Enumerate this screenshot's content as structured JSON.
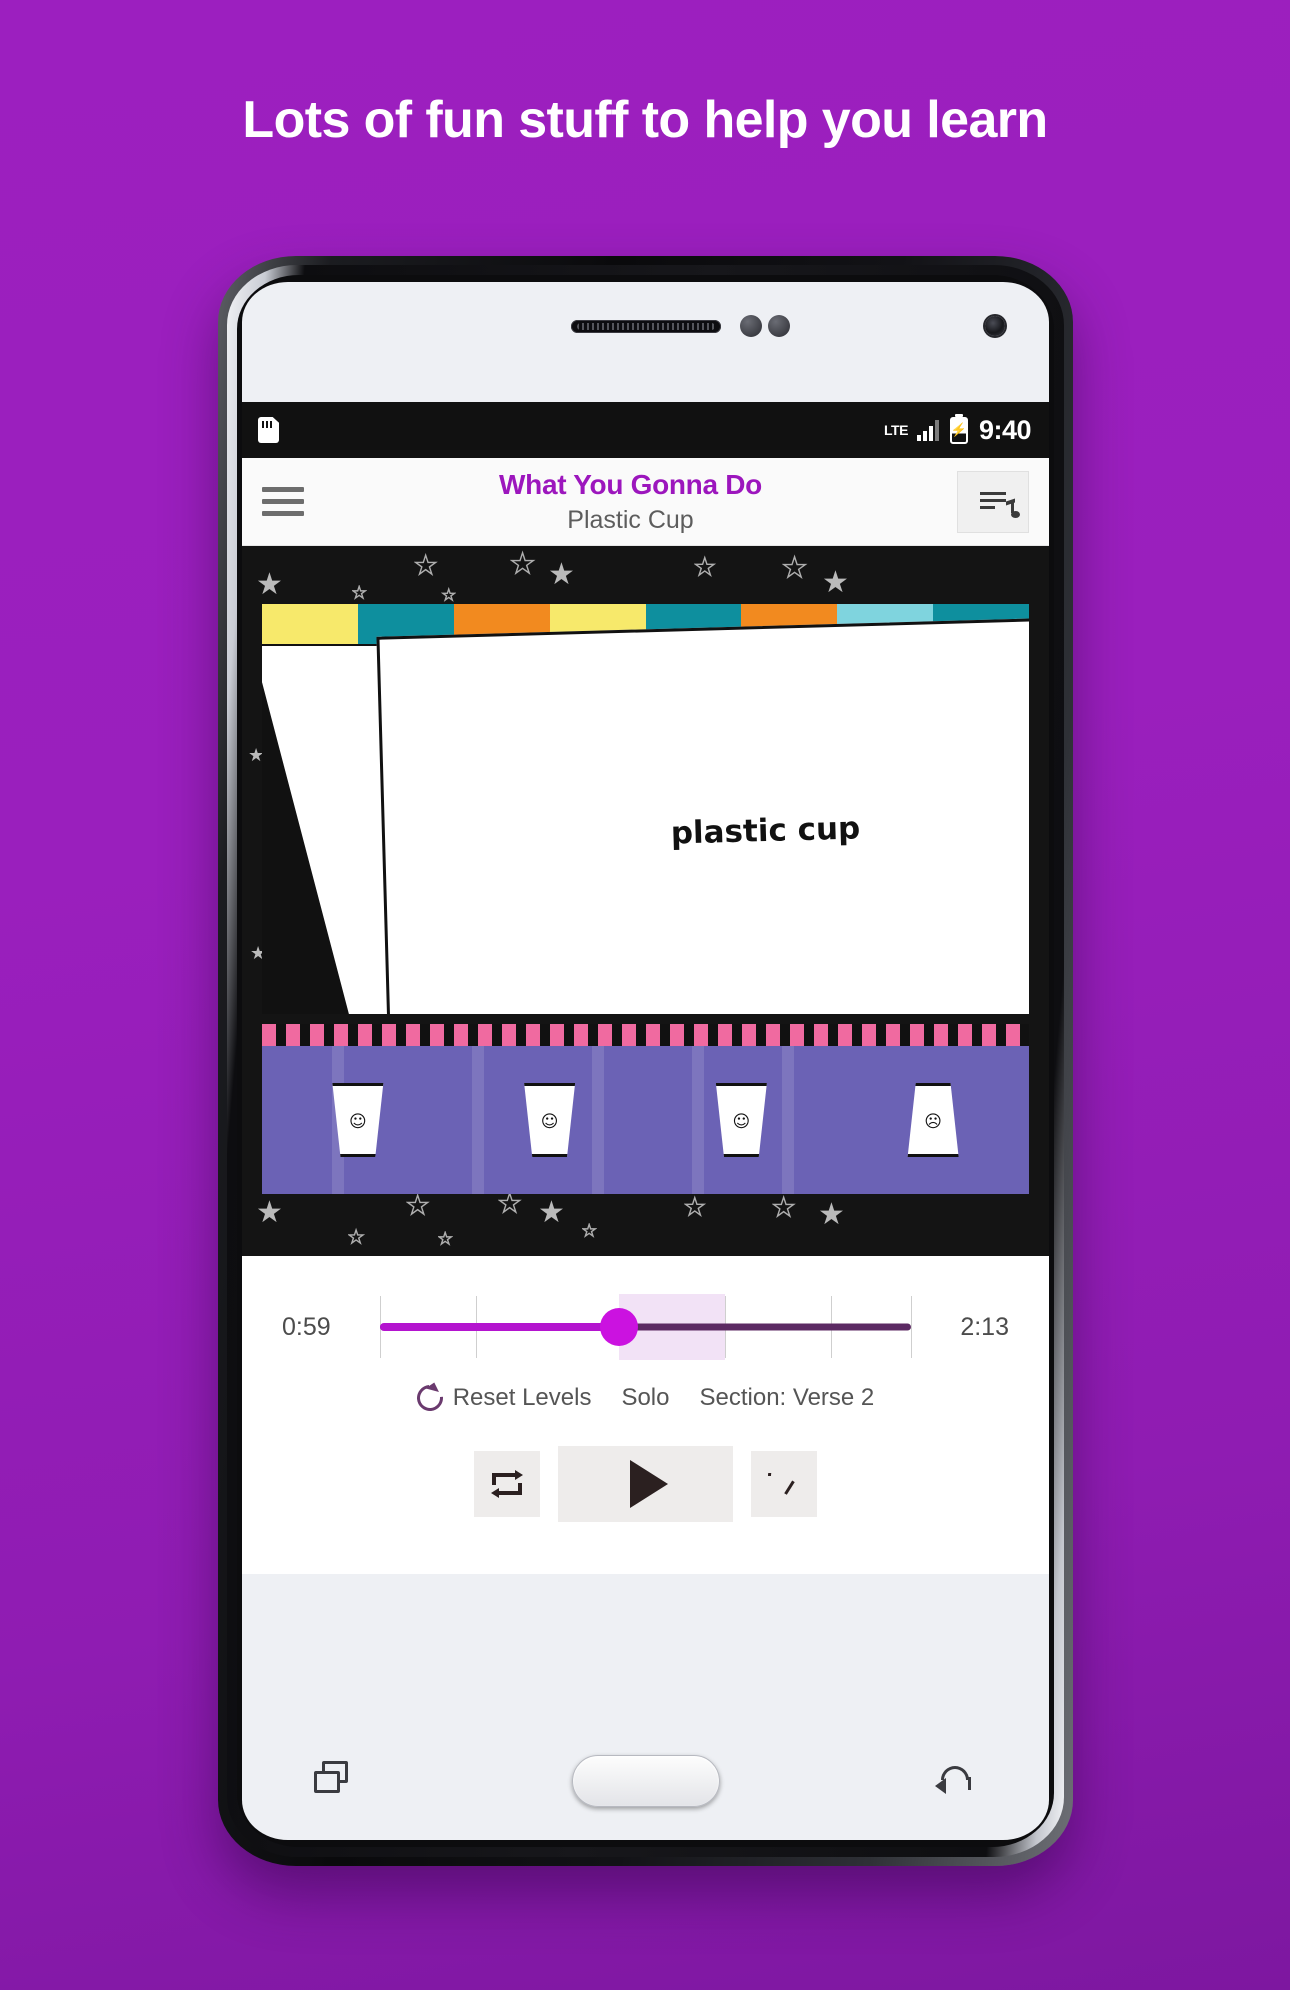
{
  "promo": {
    "headline": "Lots of fun stuff to help you learn",
    "background_color": "#9b1fbe"
  },
  "device": {
    "statusbar": {
      "sd_icon": "sd-card-icon",
      "network_label": "LTE",
      "signal_icon": "signal-bars-icon",
      "battery_icon": "battery-charging-icon",
      "time": "9:40"
    },
    "navbar": {
      "recents": "recents-icon",
      "home": "home-button",
      "back": "back-icon"
    }
  },
  "app": {
    "toolbar": {
      "menu_icon": "hamburger-menu-icon",
      "song_title": "What You Gonna Do",
      "artist": "Plastic Cup",
      "playlist_icon": "playlist-music-icon",
      "title_color": "#9c16bd"
    },
    "artwork": {
      "album_banner_text": "plastic cup",
      "drum_head_line1": "plastic",
      "drum_head_line2": "cup",
      "background_color": "#141414",
      "cup_strip_color": "#6b62b5"
    },
    "player": {
      "elapsed_time": "0:59",
      "total_time": "2:13",
      "progress_percent": 45,
      "section_start_percent": 45,
      "section_end_percent": 65,
      "track_color": "#b414cf",
      "thumb_color": "#cb12e0"
    },
    "options": {
      "reset_icon": "reset-levels-icon",
      "reset_label": "Reset Levels",
      "solo_label": "Solo",
      "section_label": "Section: Verse 2"
    },
    "transport": {
      "loop_icon": "loop-repeat-icon",
      "play_icon": "play-icon",
      "tempo_icon": "tempo-dial-icon"
    }
  }
}
